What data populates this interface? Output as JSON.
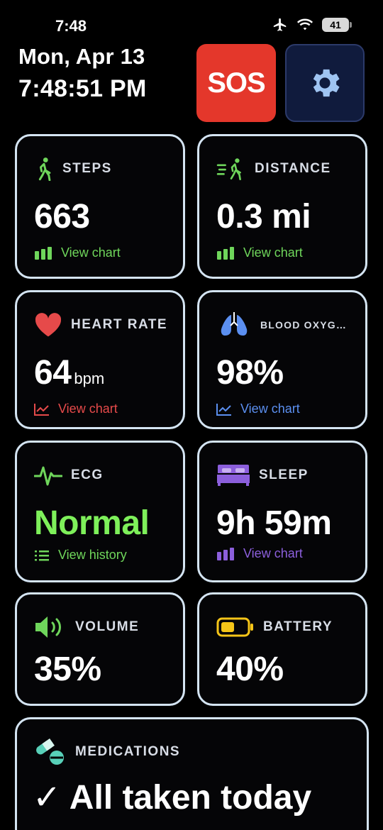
{
  "status": {
    "time": "7:48",
    "battery_level": "41",
    "icons": [
      "airplane-icon",
      "wifi-icon",
      "battery-icon"
    ]
  },
  "header": {
    "date": "Mon, Apr 13",
    "clock": "7:48:51 PM"
  },
  "actions": {
    "sos_label": "SOS",
    "settings_icon": "gear-icon"
  },
  "colors": {
    "green": "#6fd65b",
    "red": "#e64a4a",
    "blue": "#5b8ff0",
    "purple": "#8c5fdc",
    "yellow": "#f5c518",
    "teal": "#58d0b8",
    "sos": "#e4372b",
    "card_border": "#d4e4f2"
  },
  "cards": {
    "steps": {
      "title": "STEPS",
      "value": "663",
      "link": "View chart"
    },
    "distance": {
      "title": "DISTANCE",
      "value": "0.3 mi",
      "link": "View chart"
    },
    "heart": {
      "title": "HEART RATE",
      "value": "64",
      "unit": "bpm",
      "link": "View chart"
    },
    "oxygen": {
      "title": "BLOOD OXYG…",
      "value": "98%",
      "link": "View chart"
    },
    "ecg": {
      "title": "ECG",
      "value": "Normal",
      "link": "View history"
    },
    "sleep": {
      "title": "SLEEP",
      "value": "9h 59m",
      "link": "View chart"
    },
    "volume": {
      "title": "VOLUME",
      "value": "35%"
    },
    "battery": {
      "title": "BATTERY",
      "value": "40%"
    },
    "medications": {
      "title": "MEDICATIONS",
      "value": "✓ All taken today"
    }
  }
}
